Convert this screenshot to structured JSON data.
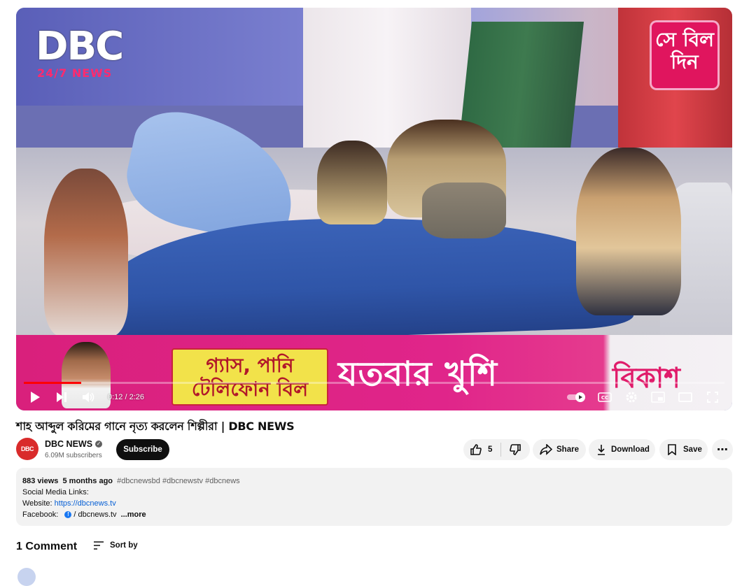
{
  "player": {
    "logo_main": "DBC",
    "logo_sub_a": "24/7",
    "logo_sub_b": "NEWS",
    "promo_text": "সে বিল দিন",
    "banner_box_line1": "গ্যাস, পানি",
    "banner_box_line2": "টেলিফোন বিল",
    "banner_text": "যতবার খুশি",
    "banner_brand": "বিকাশ",
    "time_display": "0:12 / 2:26",
    "progress_fraction": 0.082,
    "icons": [
      "play-icon",
      "next-icon",
      "volume-icon",
      "autoplay-toggle-icon",
      "captions-icon",
      "settings-icon",
      "miniplayer-icon",
      "theater-icon",
      "fullscreen-icon"
    ]
  },
  "video": {
    "title": "শাহ আব্দুল করিমের গানে নৃত্য করলেন শিল্পীরা | DBC NEWS"
  },
  "channel": {
    "avatar_text": "DBC",
    "name": "DBC NEWS",
    "verified_mark": "✓",
    "subscribers": "6.09M subscribers",
    "subscribe_label": "Subscribe"
  },
  "actions": {
    "like_count": "5",
    "share_label": "Share",
    "download_label": "Download",
    "save_label": "Save",
    "more_label": "⋯"
  },
  "description": {
    "views": "883 views",
    "age": "5 months ago",
    "tags": "#dbcnewsbd #dbcnewstv #dbcnews",
    "line1": "Social Media Links:",
    "website_label": "Website: ",
    "website_url": "https://dbcnews.tv",
    "facebook_label": "Facebook: ",
    "facebook_icon": "f",
    "facebook_handle": "/ dbcnews.tv",
    "more_label": "...more"
  },
  "comments": {
    "count_label": "1 Comment",
    "sort_label": "Sort by"
  }
}
